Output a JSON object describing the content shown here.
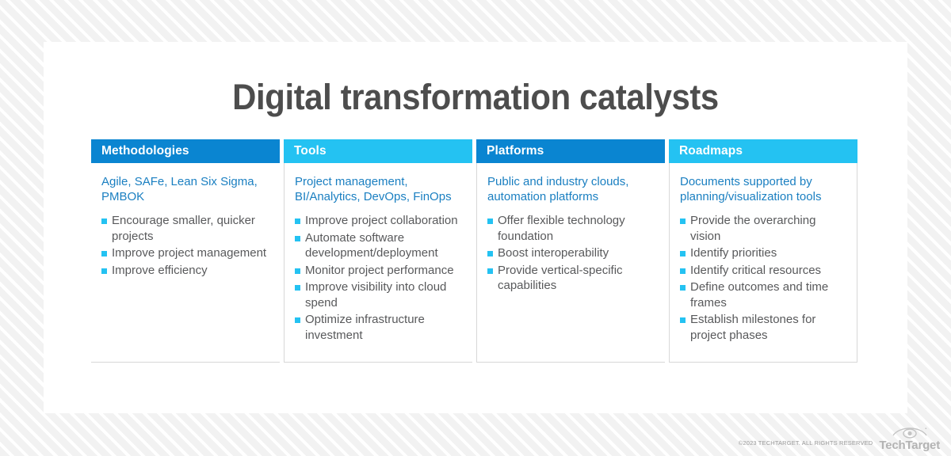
{
  "title": "Digital transformation catalysts",
  "columns": [
    {
      "header": "Methodologies",
      "header_style": "dark",
      "subtitle": "Agile, SAFe, Lean Six Sigma, PMBOK",
      "bullets": [
        "Encourage smaller, quicker projects",
        "Improve project management",
        "Improve efficiency"
      ]
    },
    {
      "header": "Tools",
      "header_style": "light",
      "subtitle": "Project management, BI/Analytics, DevOps, FinOps",
      "bullets": [
        "Improve project collaboration",
        "Automate software development/deployment",
        "Monitor project performance",
        "Improve visibility into cloud spend",
        "Optimize infrastructure investment"
      ]
    },
    {
      "header": "Platforms",
      "header_style": "dark",
      "subtitle": "Public and industry clouds, automation platforms",
      "bullets": [
        "Offer flexible technology foundation",
        "Boost interoperability",
        "Provide vertical-specific capabilities"
      ]
    },
    {
      "header": "Roadmaps",
      "header_style": "light",
      "subtitle": "Documents supported by planning/visualization tools",
      "bullets": [
        "Provide the overarching vision",
        "Identify priorities",
        "Identify critical resources",
        "Define outcomes and time frames",
        "Establish milestones for project phases"
      ]
    }
  ],
  "footer": {
    "copyright": "©2023 TECHTARGET. ALL RIGHTS RESERVED",
    "logo_text": "TechTarget"
  },
  "colors": {
    "header_dark": "#0a85d1",
    "header_light": "#24c2f2",
    "subtitle_blue": "#1a7fc1",
    "bullet_square": "#24c2f2",
    "body_text": "#58595b",
    "title_text": "#4d4d4d"
  }
}
